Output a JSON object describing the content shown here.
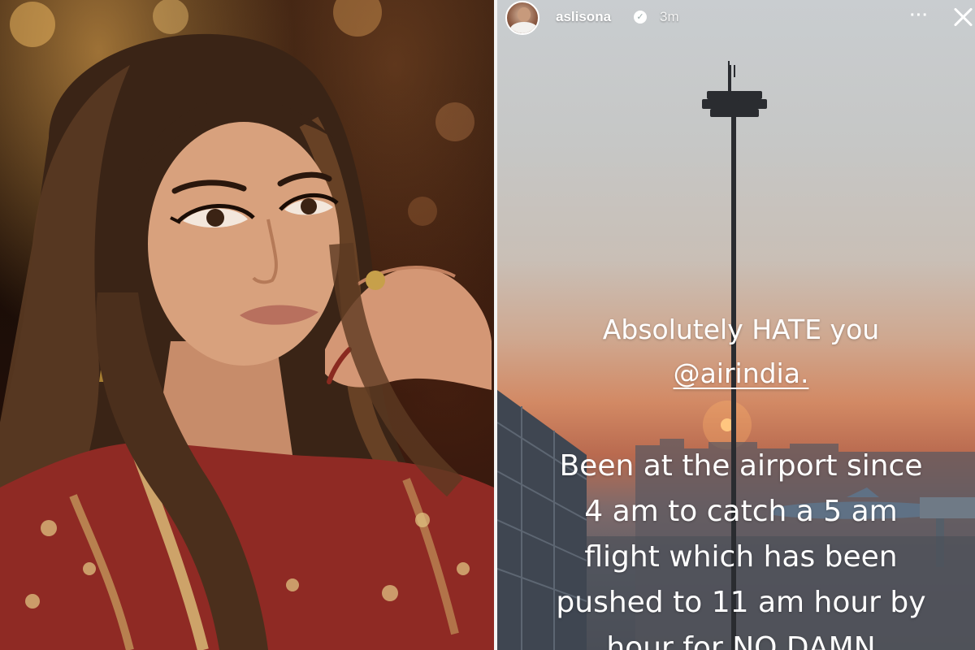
{
  "story": {
    "username": "aslisona",
    "time": "3m",
    "more_label": "···",
    "line1": "Absolutely HATE you",
    "mention": "@airindia.",
    "paragraph": [
      "Been at the airport since",
      "4 am to catch a 5 am",
      "flight which has been",
      "pushed to 11 am hour by",
      "hour for NO DAMN"
    ]
  },
  "icons": {
    "verified": "verified-badge-icon",
    "more": "more-options-icon",
    "close": "close-icon"
  },
  "colors": {
    "divider": "#f4f4f4",
    "text": "#ffffff",
    "sunset": "#d2876a",
    "sun": "#ffd28a"
  }
}
